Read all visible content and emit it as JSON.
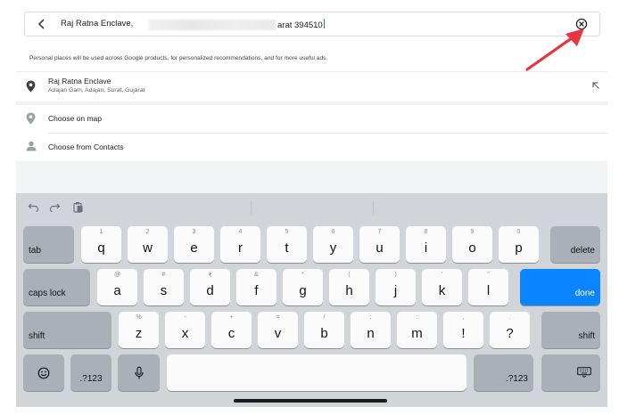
{
  "search": {
    "value_start": "Raj Ratna Enclave,",
    "value_end": "arat 394510"
  },
  "notice": "Personal places will be used across Google products, for personalized recommendations, and for more useful ads.",
  "suggestion": {
    "title": "Raj Ratna Enclave",
    "subtitle": "Adajan Gam, Adajan, Surat, Gujarat"
  },
  "options": {
    "choose_on_map": "Choose on map",
    "choose_from_contacts": "Choose from Contacts"
  },
  "keyboard": {
    "row1_left": "tab",
    "row1": [
      {
        "main": "q",
        "alt": "1"
      },
      {
        "main": "w",
        "alt": "2"
      },
      {
        "main": "e",
        "alt": "3"
      },
      {
        "main": "r",
        "alt": "4"
      },
      {
        "main": "t",
        "alt": "5"
      },
      {
        "main": "y",
        "alt": "6"
      },
      {
        "main": "u",
        "alt": "7"
      },
      {
        "main": "i",
        "alt": "8"
      },
      {
        "main": "o",
        "alt": "9"
      },
      {
        "main": "p",
        "alt": "0"
      }
    ],
    "row1_right": "delete",
    "row2_left": "caps lock",
    "row2": [
      {
        "main": "a",
        "alt": "@"
      },
      {
        "main": "s",
        "alt": "#"
      },
      {
        "main": "d",
        "alt": "₹"
      },
      {
        "main": "f",
        "alt": "&"
      },
      {
        "main": "g",
        "alt": "*"
      },
      {
        "main": "h",
        "alt": "("
      },
      {
        "main": "j",
        "alt": ")"
      },
      {
        "main": "k",
        "alt": "'"
      },
      {
        "main": "l",
        "alt": "\""
      }
    ],
    "row2_right": "done",
    "row3_left": "shift",
    "row3": [
      {
        "main": "z",
        "alt": "%"
      },
      {
        "main": "x",
        "alt": "-"
      },
      {
        "main": "c",
        "alt": "+"
      },
      {
        "main": "v",
        "alt": "="
      },
      {
        "main": "b",
        "alt": "/"
      },
      {
        "main": "n",
        "alt": ";"
      },
      {
        "main": "m",
        "alt": ":"
      },
      {
        "main": "!",
        "alt": ","
      },
      {
        "main": "?",
        "alt": "."
      }
    ],
    "row3_right": "shift",
    "num_left": ".?123",
    "num_right": ".?123"
  },
  "colors": {
    "accent_blue": "#0a84ff",
    "annotation_red": "#e8353d"
  }
}
